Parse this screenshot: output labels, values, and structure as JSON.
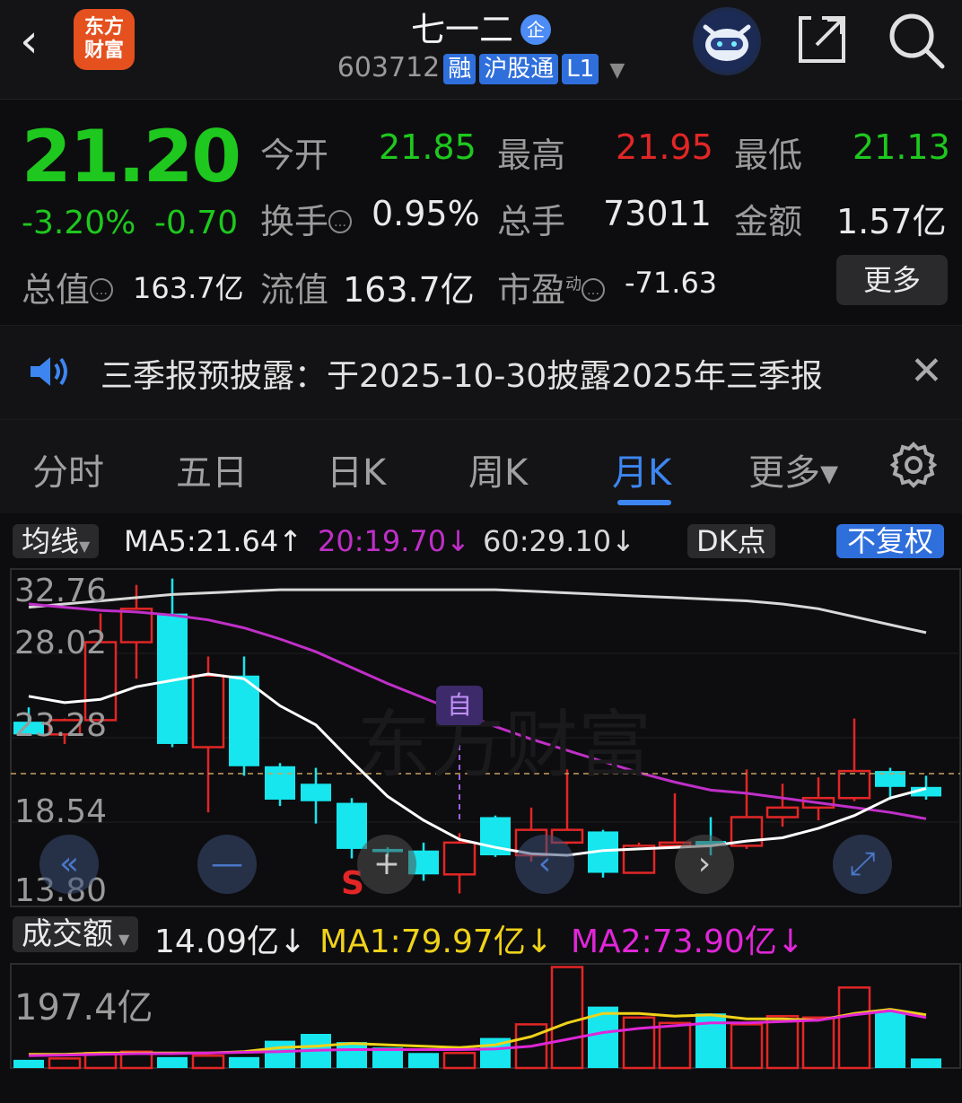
{
  "header": {
    "stock_name": "七一二",
    "badge": "企",
    "code": "603712",
    "tags": [
      "融",
      "沪股通",
      "L1"
    ],
    "logo_text": [
      "东方",
      "财富"
    ]
  },
  "quote": {
    "price": "21.20",
    "change_pct": "-3.20%",
    "change_abs": "-0.70",
    "open_label": "今开",
    "open": "21.85",
    "high_label": "最高",
    "high": "21.95",
    "low_label": "最低",
    "low": "21.13",
    "turnover_label": "换手",
    "turnover": "0.95%",
    "volume_label": "总手",
    "volume": "73011",
    "amount_label": "金额",
    "amount": "1.57亿",
    "total_cap_label": "总值",
    "total_cap": "163.7亿",
    "float_cap_label": "流值",
    "float_cap": "163.7亿",
    "pe_label": "市盈",
    "pe_sup": "动",
    "pe": "-71.63",
    "more_label": "更多"
  },
  "notice": {
    "text": "三季报预披露：于2025-10-30披露2025年三季报"
  },
  "tabs": [
    "分时",
    "五日",
    "日K",
    "周K",
    "月K",
    "更多▾"
  ],
  "active_tab": 4,
  "kline": {
    "indicator_label": "均线",
    "ma5": "MA5:21.64↑",
    "ma20": "20:19.70↓",
    "ma60": "60:29.10↓",
    "dk_label": "DK点",
    "adjust_label": "不复权",
    "y_ticks": [
      "32.76",
      "28.02",
      "23.28",
      "18.54",
      "13.80"
    ],
    "marker_zi": "自",
    "marker_s": "S",
    "watermark": "东方财富",
    "colors": {
      "up": "#e22626",
      "down": "#17e6ee",
      "ma5": "#ffffff",
      "ma20": "#c02fc8",
      "ma60": "#d8d8d8"
    }
  },
  "volume": {
    "indicator_label": "成交额",
    "value": "14.09亿↓",
    "ma1": "MA1:79.97亿↓",
    "ma2": "MA2:73.90亿↓",
    "y_top": "197.4亿"
  },
  "chart_data": {
    "type": "candlestick",
    "ylim": [
      13.8,
      32.76
    ],
    "candles": [
      {
        "o": 24.4,
        "c": 23.6,
        "h": 25.3,
        "l": 23.6
      },
      {
        "o": 23.6,
        "c": 24.5,
        "h": 24.6,
        "l": 23.0
      },
      {
        "o": 24.5,
        "c": 29.4,
        "h": 31.2,
        "l": 24.3
      },
      {
        "o": 29.4,
        "c": 31.5,
        "h": 33.0,
        "l": 27.1
      },
      {
        "o": 31.2,
        "c": 23.0,
        "h": 33.4,
        "l": 22.8
      },
      {
        "o": 22.8,
        "c": 27.3,
        "h": 28.5,
        "l": 18.7
      },
      {
        "o": 27.3,
        "c": 21.6,
        "h": 28.5,
        "l": 21.0
      },
      {
        "o": 21.6,
        "c": 19.5,
        "h": 21.8,
        "l": 19.1
      },
      {
        "o": 20.5,
        "c": 19.4,
        "h": 21.5,
        "l": 18.0
      },
      {
        "o": 19.3,
        "c": 16.4,
        "h": 19.6,
        "l": 15.8
      },
      {
        "o": 16.4,
        "c": 16.2,
        "h": 16.5,
        "l": 15.9
      },
      {
        "o": 16.3,
        "c": 14.8,
        "h": 16.8,
        "l": 14.4
      },
      {
        "o": 14.8,
        "c": 16.8,
        "h": 17.4,
        "l": 13.6
      },
      {
        "o": 18.4,
        "c": 16.0,
        "h": 18.5,
        "l": 15.9
      },
      {
        "o": 16.0,
        "c": 17.6,
        "h": 19.0,
        "l": 15.6
      },
      {
        "o": 16.8,
        "c": 17.6,
        "h": 21.4,
        "l": 16.7
      },
      {
        "o": 17.5,
        "c": 14.9,
        "h": 17.6,
        "l": 14.6
      },
      {
        "o": 14.9,
        "c": 16.6,
        "h": 16.8,
        "l": 14.9
      },
      {
        "o": 16.6,
        "c": 16.8,
        "h": 19.9,
        "l": 16.5
      },
      {
        "o": 16.9,
        "c": 16.6,
        "h": 18.4,
        "l": 16.0
      },
      {
        "o": 16.6,
        "c": 18.4,
        "h": 21.4,
        "l": 16.4
      },
      {
        "o": 18.4,
        "c": 19.0,
        "h": 20.5,
        "l": 17.8
      },
      {
        "o": 19.0,
        "c": 19.6,
        "h": 20.9,
        "l": 18.2
      },
      {
        "o": 19.6,
        "c": 21.3,
        "h": 24.6,
        "l": 19.4
      },
      {
        "o": 21.3,
        "c": 20.3,
        "h": 21.5,
        "l": 19.5
      },
      {
        "o": 20.3,
        "c": 19.7,
        "h": 21.0,
        "l": 19.5
      }
    ],
    "ma5": [
      26.0,
      25.6,
      25.8,
      26.6,
      27.0,
      27.4,
      27.1,
      25.4,
      24.2,
      21.9,
      19.7,
      18.2,
      17.0,
      16.5,
      16.1,
      16.0,
      16.3,
      16.4,
      16.5,
      16.6,
      16.9,
      17.1,
      17.7,
      18.5,
      19.6,
      20.2
    ],
    "ma20": [
      31.8,
      31.6,
      31.4,
      31.3,
      31.1,
      30.8,
      30.3,
      29.6,
      28.8,
      27.8,
      26.8,
      25.9,
      25.0,
      24.1,
      23.3,
      22.6,
      21.9,
      21.2,
      20.6,
      20.1,
      19.9,
      19.6,
      19.3,
      19.0,
      18.7,
      18.3
    ],
    "ma60": [
      31.6,
      31.8,
      32.0,
      32.2,
      32.4,
      32.5,
      32.6,
      32.7,
      32.7,
      32.7,
      32.7,
      32.7,
      32.7,
      32.7,
      32.6,
      32.5,
      32.4,
      32.3,
      32.2,
      32.1,
      32.0,
      31.8,
      31.5,
      31.0,
      30.5,
      30.0
    ],
    "volume": [
      12,
      14,
      22,
      24,
      16,
      18,
      16,
      40,
      50,
      38,
      30,
      22,
      22,
      44,
      64,
      148,
      90,
      74,
      66,
      80,
      64,
      76,
      74,
      118,
      84,
      14
    ],
    "vol_ma1": [
      20,
      20,
      22,
      22,
      22,
      22,
      24,
      30,
      32,
      36,
      34,
      32,
      30,
      34,
      46,
      66,
      80,
      80,
      76,
      78,
      72,
      72,
      70,
      80,
      86,
      78
    ],
    "vol_ma2": [
      18,
      19,
      20,
      21,
      21,
      22,
      23,
      24,
      26,
      27,
      27,
      27,
      27,
      28,
      32,
      42,
      52,
      58,
      62,
      66,
      66,
      68,
      70,
      78,
      84,
      74
    ]
  }
}
